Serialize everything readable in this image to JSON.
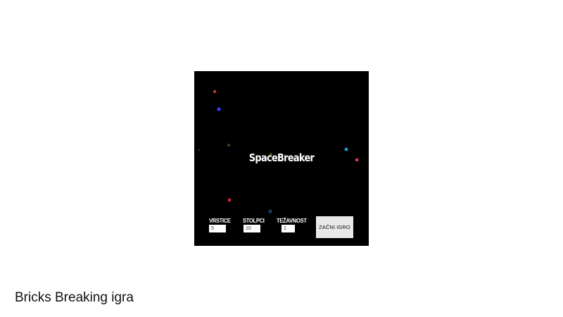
{
  "game": {
    "title": "SpaceBreaker",
    "background": "#000000",
    "controls": {
      "rows": {
        "label": "VRSTICE",
        "value": "5"
      },
      "columns": {
        "label": "STOLPCI",
        "value": "10"
      },
      "difficulty": {
        "label": "TEŽAVNOST",
        "value": "1"
      }
    },
    "start_button_label": "ZAČNI IGRO",
    "star_colors": [
      "#c0392b",
      "#3b3bff",
      "#3a4a1a",
      "#1e5ad8",
      "#e8368f",
      "#2b2b2b",
      "#5a6a1a",
      "#d02030",
      "#1a3a6a"
    ]
  },
  "caption": "Bricks Breaking igra"
}
